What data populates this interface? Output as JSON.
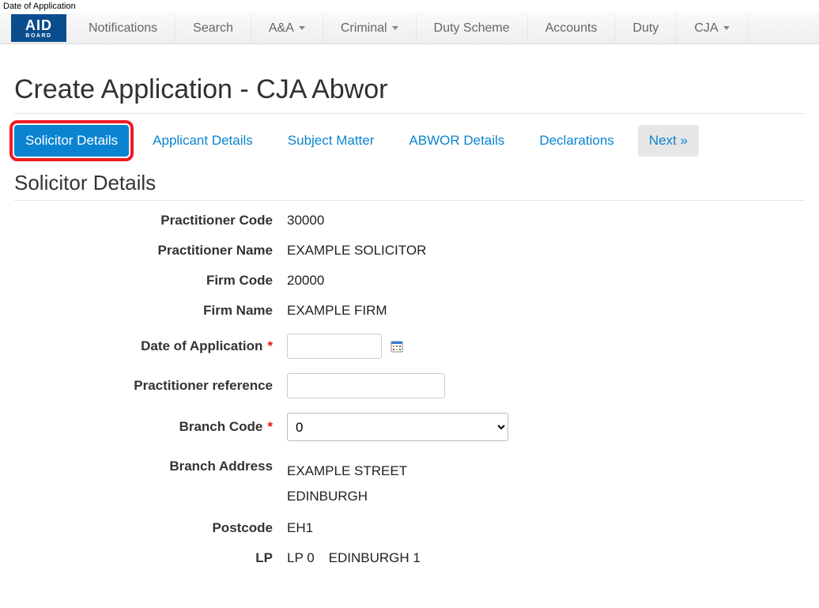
{
  "top_label": "Date of Application",
  "logo": {
    "main": "AID",
    "sub": "BOARD"
  },
  "nav": [
    {
      "label": "Notifications",
      "dropdown": false
    },
    {
      "label": "Search",
      "dropdown": false
    },
    {
      "label": "A&A",
      "dropdown": true
    },
    {
      "label": "Criminal",
      "dropdown": true
    },
    {
      "label": "Duty Scheme",
      "dropdown": false
    },
    {
      "label": "Accounts",
      "dropdown": false
    },
    {
      "label": "Duty",
      "dropdown": false
    },
    {
      "label": "CJA",
      "dropdown": true
    }
  ],
  "page_title": "Create Application - CJA Abwor",
  "tabs": {
    "items": [
      "Solicitor Details",
      "Applicant Details",
      "Subject Matter",
      "ABWOR Details",
      "Declarations"
    ],
    "next_label": "Next »"
  },
  "section_title": "Solicitor Details",
  "form": {
    "practitioner_code": {
      "label": "Practitioner Code",
      "value": "30000"
    },
    "practitioner_name": {
      "label": "Practitioner Name",
      "value": "EXAMPLE SOLICITOR"
    },
    "firm_code": {
      "label": "Firm Code",
      "value": "20000"
    },
    "firm_name": {
      "label": "Firm Name",
      "value": "EXAMPLE FIRM"
    },
    "date_of_application": {
      "label": "Date of Application",
      "value": ""
    },
    "practitioner_reference": {
      "label": "Practitioner reference",
      "value": ""
    },
    "branch_code": {
      "label": "Branch Code",
      "selected": "0"
    },
    "branch_address": {
      "label": "Branch Address",
      "line1": "EXAMPLE STREET",
      "line2": "EDINBURGH"
    },
    "postcode": {
      "label": "Postcode",
      "value": "EH1"
    },
    "lp": {
      "label": "LP",
      "code": "LP 0",
      "area": "EDINBURGH 1"
    }
  }
}
